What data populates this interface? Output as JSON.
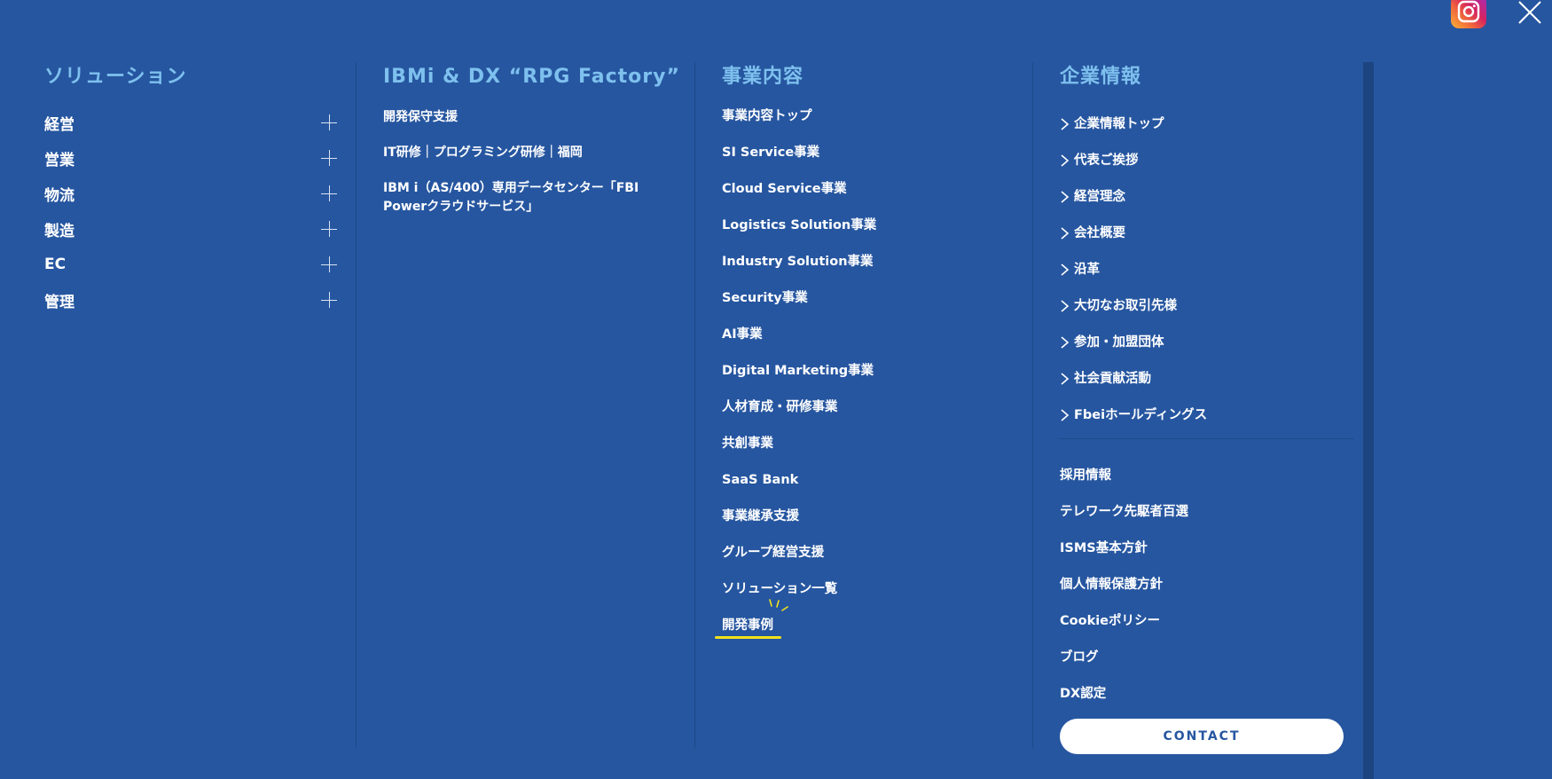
{
  "solutions": {
    "title": "ソリューション",
    "items": [
      "経営",
      "営業",
      "物流",
      "製造",
      "EC",
      "管理"
    ]
  },
  "ibmi": {
    "title": "IBMi & DX “RPG Factory”",
    "links": [
      "開発保守支援",
      "IT研修｜プログラミング研修｜福岡",
      "IBM i（AS/400）専用データセンター「FBI Powerクラウドサービス」"
    ]
  },
  "business": {
    "title": "事業内容",
    "links": [
      "事業内容トップ",
      "SI Service事業",
      "Cloud Service事業",
      "Logistics Solution事業",
      "Industry Solution事業",
      "Security事業",
      "AI事業",
      "Digital Marketing事業",
      "人材育成・研修事業",
      "共創事業",
      "SaaS Bank",
      "事業継承支援",
      "グループ経営支援",
      "ソリューション一覧",
      "開発事例"
    ]
  },
  "company": {
    "title": "企業情報",
    "links": [
      "企業情報トップ",
      "代表ご挨拶",
      "経営理念",
      "会社概要",
      "沿革",
      "大切なお取引先様",
      "参加・加盟団体",
      "社会貢献活動",
      "Fbeiホールディングス"
    ],
    "extra_links": [
      "採用情報",
      "テレワーク先駆者百選",
      "ISMS基本方針",
      "個人情報保護方針",
      "Cookieポリシー",
      "ブログ",
      "DX認定"
    ],
    "contact_label": "CONTACT"
  },
  "colors": {
    "background": "#2656a0",
    "title": "#7ec0ee",
    "highlight": "#f2e21a"
  },
  "icons": {
    "social": "instagram-icon",
    "close": "close-icon",
    "expand": "plus-icon",
    "link_prefix": "chevron-right-icon"
  }
}
